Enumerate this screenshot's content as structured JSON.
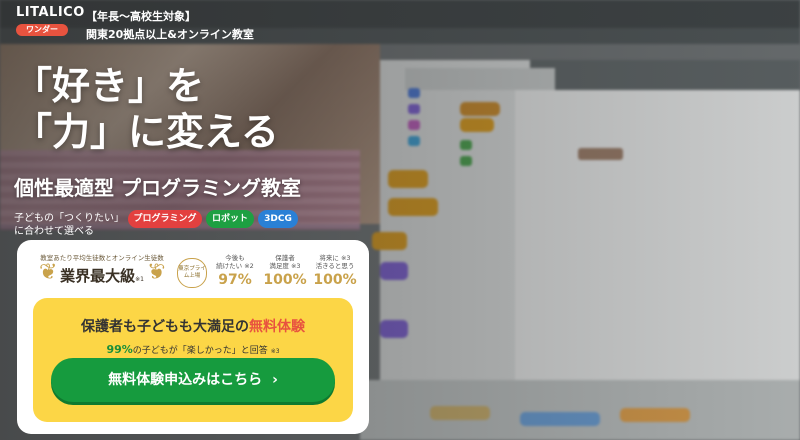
{
  "brand": {
    "logo_word": "LITALICO",
    "logo_sub": "ワンダー",
    "tagline_1": "【年長〜高校生対象】",
    "tagline_2": "関東20拠点以上&オンライン教室"
  },
  "hero": {
    "headline_1": "「好き」を",
    "headline_2": "「力」に変える",
    "subheadline": "個性最適型 プログラミング教室",
    "desc_1": "子どもの「つくりたい」",
    "desc_2": "に合わせて選べる",
    "pills": [
      {
        "label": "プログラミング",
        "color": "#e3403f"
      },
      {
        "label": "ロボット",
        "color": "#1ea042"
      },
      {
        "label": "3DCG",
        "color": "#2a80d6"
      }
    ]
  },
  "card": {
    "award_small": "教室あたり平均生徒数とオンライン生徒数",
    "award_big": "業界最大級",
    "award_note": "※1",
    "seal_text": "東京プライム上場",
    "stats": [
      {
        "label_1": "今後も",
        "label_2": "続けたい ※2",
        "value": "97%"
      },
      {
        "label_1": "保護者",
        "label_2": "満足度 ※3",
        "value": "100%"
      },
      {
        "label_1": "将来に ※3",
        "label_2": "活きると思う",
        "value": "100%"
      }
    ],
    "cta_box": {
      "title_main": "保護者も子どもも大満足の",
      "title_highlight": "無料体験",
      "sub_percent": "99%",
      "sub_text": "の子どもが「楽しかった」と回答",
      "sub_note": "※3",
      "button_label": "無料体験申込みはこちら",
      "button_icon": "chevron-right-icon"
    }
  },
  "colors": {
    "accent_red": "#e8533f",
    "accent_green": "#169b3e",
    "accent_yellow": "#fcd646",
    "gold": "#c9a24b"
  }
}
